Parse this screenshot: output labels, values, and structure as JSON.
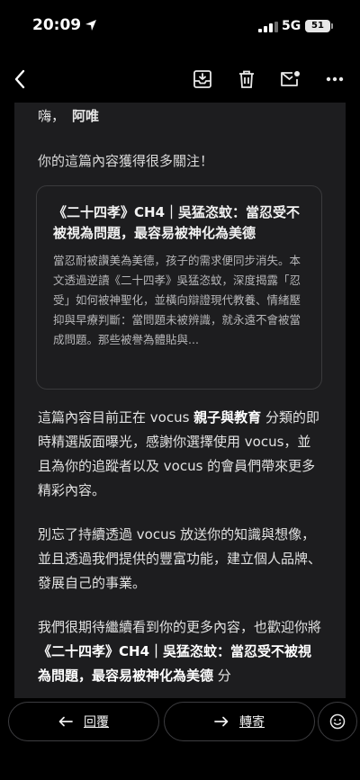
{
  "status_bar": {
    "time": "20:09",
    "network": "5G",
    "battery": "51"
  },
  "toolbar": {
    "back_icon": "chevron-left-icon",
    "archive_icon": "archive-icon",
    "delete_icon": "trash-icon",
    "unread_icon": "mail-unread-icon",
    "more_icon": "more-icon"
  },
  "email": {
    "greeting": "嗨，",
    "recipient": "阿唯",
    "intro": "你的這篇內容獲得很多關注！",
    "quote": {
      "title": "《二十四孝》CH4｜吳猛恣蚊：當忍受不被視為問題，最容易被神化為美德",
      "excerpt": "當忍耐被讚美為美德，孩子的需求便同步消失。本文透過逆讀《二十四孝》吳猛恣蚊，深度揭露「忍受」如何被神聖化，並橫向辯證現代教養、情緒壓抑與早療判斷：當問題未被辨識，就永遠不會被當成問題。那些被譽為體貼與..."
    },
    "para1": {
      "before": "這篇內容目前正在 vocus ",
      "category": "親子與教育",
      "after": " 分類的即時精選版面曝光，感謝你選擇使用 vocus，並且為你的追蹤者以及 vocus 的會員們帶來更多精彩內容。"
    },
    "para2": "別忘了持續透過 vocus 放送你的知識與想像，並且透過我們提供的豐富功能，建立個人品牌、發展自己的事業。",
    "para3": {
      "before": "我們很期待繼續看到你的更多內容，也歡迎你將 ",
      "title": "《二十四孝》CH4｜吳猛恣蚊：當忍受不被視為問題，最容易被神化為美德",
      "after": " 分"
    }
  },
  "actions": {
    "reply_label": "回覆",
    "forward_label": "轉寄",
    "reply_icon": "reply-arrow-icon",
    "forward_icon": "forward-arrow-icon",
    "emoji_icon": "emoji-icon"
  }
}
